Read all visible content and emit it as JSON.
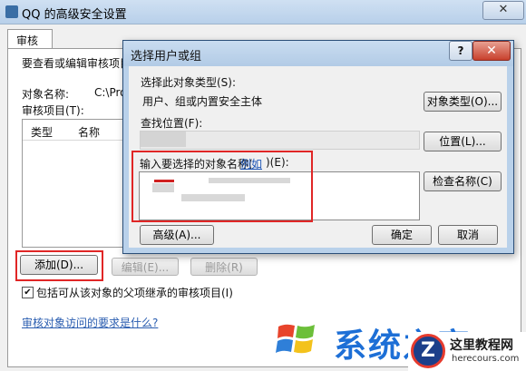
{
  "back_window": {
    "title": "QQ 的高级安全设置",
    "close_glyph": "✕",
    "tab": "审核",
    "intro_text": "要查看或编辑审核项目的",
    "object_name_label": "对象名称:",
    "object_name_value": "C:\\Pro",
    "audit_items_label": "审核项目(T):",
    "columns": [
      "类型",
      "名称"
    ],
    "add_button": "添加(D)...",
    "edit_button": "编辑(E)...",
    "remove_button": "删除(R)",
    "inherit_label": "包括可从该对象的父项继承的审核项目(I)",
    "help_link": "审核对象访问的要求是什么?"
  },
  "dialog": {
    "title": "选择用户或组",
    "help_glyph": "?",
    "close_glyph": "✕",
    "object_type_label": "选择此对象类型(S):",
    "object_type_value": "用户、组或内置安全主体",
    "object_type_button": "对象类型(O)...",
    "location_label": "查找位置(F):",
    "location_button": "位置(L)...",
    "names_label_pre": "输入要选择的对象名称(",
    "example_link": "例如",
    "names_label_post": ")(E):",
    "check_names_button": "检查名称(C)",
    "advanced_button": "高级(A)...",
    "ok_button": "确定",
    "cancel_button": "取消"
  },
  "watermark": {
    "text": "系统之家",
    "badge_letter": "Z",
    "badge_title": "这里教程网",
    "badge_url": "herecours.com"
  },
  "colors": {
    "highlight": "#e02626",
    "link": "#2a5db0",
    "watermark_blue": "#1d6fd6"
  }
}
